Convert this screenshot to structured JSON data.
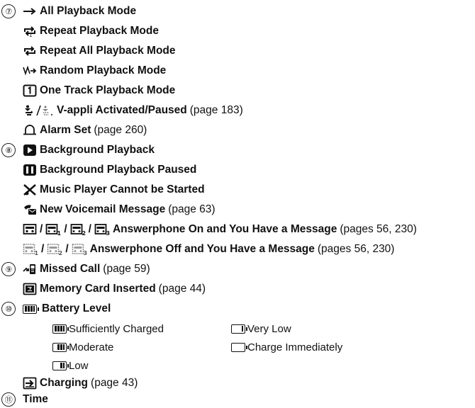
{
  "markers": {
    "m7": "⑦",
    "m8": "⑧",
    "m9": "⑨",
    "m10": "⑩",
    "m11": "⑪"
  },
  "items": {
    "all_playback": {
      "label": "All Playback Mode",
      "icon": "arrow-right-icon"
    },
    "repeat_playback": {
      "label": "Repeat Playback Mode",
      "icon": "repeat-icon"
    },
    "repeat_all": {
      "label": "Repeat All Playback Mode",
      "icon": "repeat-all-icon"
    },
    "random_playback": {
      "label": "Random Playback Mode",
      "icon": "random-icon"
    },
    "one_track": {
      "label": "One Track Playback Mode",
      "icon": "one-track-icon",
      "glyph": "1"
    },
    "vappli": {
      "label": "V-appli Activated/Paused",
      "note": "(page 183)",
      "icon": "v-appli-icon"
    },
    "alarm": {
      "label": "Alarm Set",
      "note": "(page 260)",
      "icon": "bell-icon"
    },
    "bg_playback": {
      "label": "Background Playback",
      "icon": "play-icon"
    },
    "bg_paused": {
      "label": "Background Playback Paused",
      "icon": "pause-icon"
    },
    "cannot_start": {
      "label": "Music Player Cannot be Started",
      "icon": "music-blocked-icon"
    },
    "voicemail": {
      "label": "New Voicemail Message",
      "note": "(page 63)",
      "icon": "voicemail-icon"
    },
    "answer_on": {
      "label": "Answerphone On and You Have a Message",
      "note": "(pages 56, 230)",
      "sep": "/",
      "icon": "answerphone-icon"
    },
    "answer_off": {
      "label": "Answerphone Off and You Have a Message",
      "note": "(pages 56, 230)",
      "sep": "/",
      "icon": "answerphone-off-icon"
    },
    "missed_call": {
      "label": "Missed Call",
      "note": "(page 59)",
      "icon": "missed-call-icon"
    },
    "memory_card": {
      "label": "Memory Card Inserted",
      "note": "(page 44)",
      "icon": "memory-card-icon"
    },
    "battery": {
      "label": "Battery Level",
      "icon": "battery-icon"
    },
    "charging": {
      "label": "Charging",
      "note": "(page 43)",
      "icon": "charging-icon"
    },
    "time": {
      "label": "Time"
    }
  },
  "battery_levels": {
    "sufficient": {
      "label": "Sufficiently Charged",
      "bars": 3
    },
    "very_low": {
      "label": "Very Low",
      "bars": 1
    },
    "moderate": {
      "label": "Moderate",
      "bars": 2
    },
    "charge_now": {
      "label": "Charge Immediately",
      "bars": 0
    },
    "low": {
      "label": "Low",
      "bars": 1
    }
  }
}
